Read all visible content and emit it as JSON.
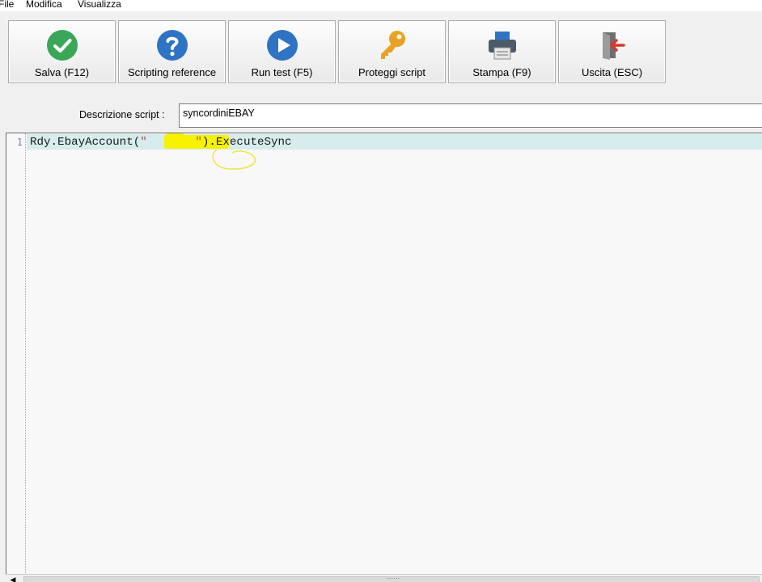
{
  "menu": {
    "items": [
      "File",
      "Modifica",
      "Visualizza"
    ]
  },
  "toolbar": {
    "buttons": [
      {
        "label": "Salva (F12)",
        "icon": "check-circle-icon"
      },
      {
        "label": "Scripting reference",
        "icon": "help-circle-icon"
      },
      {
        "label": "Run test (F5)",
        "icon": "play-circle-icon"
      },
      {
        "label": "Proteggi script",
        "icon": "key-icon"
      },
      {
        "label": "Stampa (F9)",
        "icon": "printer-icon"
      },
      {
        "label": "Uscita (ESC)",
        "icon": "exit-door-icon"
      }
    ]
  },
  "description": {
    "label": "Descrizione script :",
    "value": "syncordiniEBAY"
  },
  "editor": {
    "line_number": "1",
    "code_prefix": "Rdy.EbayAccount(",
    "code_string": "\"       \"",
    "code_suffix": ").ExecuteSync"
  },
  "colors": {
    "green": "#3aa757",
    "blue": "#2f73c4",
    "gold": "#e8a326",
    "exit_red": "#d33a2c",
    "highlight_yellow": "#f6f200"
  }
}
